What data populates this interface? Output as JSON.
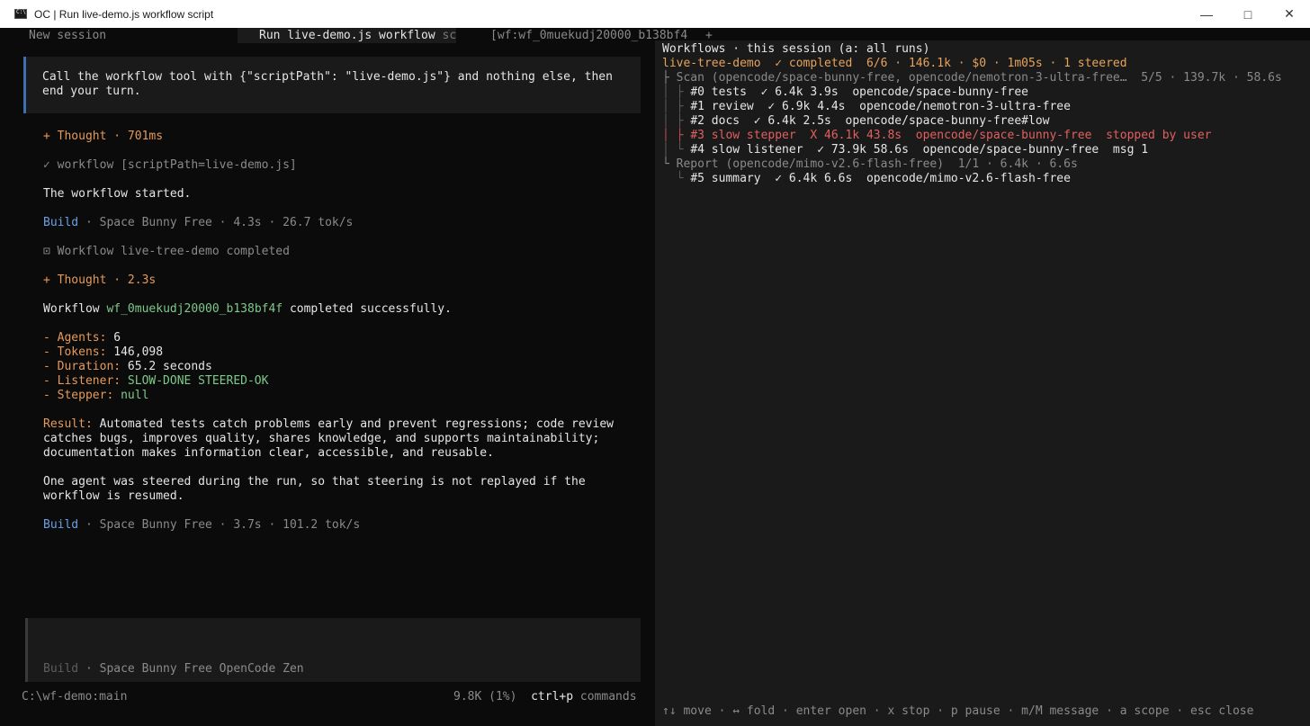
{
  "window": {
    "title": "OC | Run live-demo.js workflow script",
    "icon": "terminal-icon"
  },
  "tabs": {
    "new_session": "New session",
    "active": "Run live-demo.js workflow ",
    "active_fade": "sc",
    "workflow_tab": "[wf:wf_0muekudj20000_b138bf4",
    "add": "+"
  },
  "chat": {
    "prompt": "Call the workflow tool with {\"scriptPath\": \"live-demo.js\"} and nothing else, then\nend your turn.",
    "thought1": "+ Thought · 701ms",
    "tool_call": "✓ workflow [scriptPath=live-demo.js]",
    "started": "The workflow started.",
    "build1_label": "Build",
    "build1_meta": " · Space Bunny Free · 4.3s · 26.7 tok/s",
    "workflow_done": "⊡ Workflow live-tree-demo completed",
    "thought2": "+ Thought · 2.3s",
    "summary_pre": "Workflow ",
    "summary_id": "wf_0muekudj20000_b138bf4f",
    "summary_post": " completed successfully.",
    "stats": [
      {
        "label": "- Agents:",
        "value": " 6",
        "value_color": "white"
      },
      {
        "label": "- Tokens:",
        "value": " 146,098",
        "value_color": "white"
      },
      {
        "label": "- Duration:",
        "value": " 65.2 seconds",
        "value_color": "white"
      },
      {
        "label": "- Listener:",
        "value": " SLOW-DONE STEERED-OK",
        "value_color": "green"
      },
      {
        "label": "- Stepper:",
        "value": " null",
        "value_color": "green"
      }
    ],
    "result_label": "Result:",
    "result_line1": " Automated tests catch problems early and prevent regressions; code review",
    "result_line2": "catches bugs, improves quality, shares knowledge, and supports maintainability;",
    "result_line3": "documentation makes information clear, accessible, and reusable.",
    "note_line1": "One agent was steered during the run, so that steering is not replayed if the",
    "note_line2": "workflow is resumed.",
    "build2_label": "Build",
    "build2_meta": " · Space Bunny Free · 3.7s · 101.2 tok/s"
  },
  "input": {
    "build_label": "Build",
    "meta": " · Space Bunny Free OpenCode Zen"
  },
  "status": {
    "cwd": "C:\\wf-demo:main",
    "tokens": "9.8K (1%)",
    "shortcut": "ctrl+p",
    "shortcut_label": " commands"
  },
  "workflows": {
    "header": "Workflows · this session (a: all runs)",
    "run_name": "live-tree-demo",
    "run_meta": "  ✓ completed  6/6 · 146.1k · $0 · 1m05s · 1 steered",
    "scan_line": "├ Scan (opencode/space-bunny-free, opencode/nemotron-3-ultra-free…  5/5 · 139.7k · 58.6s",
    "agents": [
      {
        "prefix": "│ ├ ",
        "text": "#0 tests  ✓ 6.4k 3.9s  opencode/space-bunny-free",
        "state": "ok"
      },
      {
        "prefix": "│ ├ ",
        "text": "#1 review  ✓ 6.9k 4.4s  opencode/nemotron-3-ultra-free",
        "state": "ok"
      },
      {
        "prefix": "│ ├ ",
        "text": "#2 docs  ✓ 6.4k 2.5s  opencode/space-bunny-free#low",
        "state": "ok"
      },
      {
        "prefix": "│ ├ ",
        "text": "#3 slow stepper  X 46.1k 43.8s  opencode/space-bunny-free  stopped by user",
        "state": "stopped"
      },
      {
        "prefix": "│ └ ",
        "text": "#4 slow listener  ✓ 73.9k 58.6s  opencode/space-bunny-free  msg 1",
        "state": "ok"
      }
    ],
    "report_line": "└ Report (opencode/mimo-v2.6-flash-free)  1/1 · 6.4k · 6.6s",
    "report_agent_prefix": "  └ ",
    "report_agent": "#5 summary  ✓ 6.4k 6.6s  opencode/mimo-v2.6-flash-free",
    "help": "↑↓ move · ↔ fold · enter open · x stop · p pause · m/M message · a scope · esc close"
  },
  "colors": {
    "accent_blue": "#6ba0e6",
    "orange": "#e59a5b",
    "green": "#7fc98a",
    "red": "#e06060"
  }
}
